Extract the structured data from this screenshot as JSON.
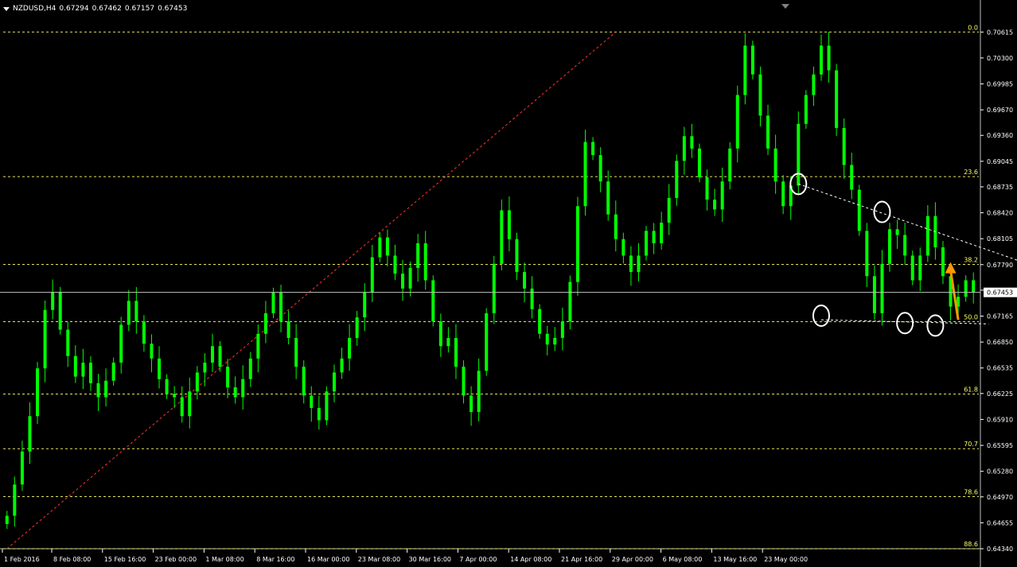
{
  "header": {
    "symbol": "NZDUSD,H4",
    "open": "0.67294",
    "high": "0.67462",
    "low": "0.67157",
    "close": "0.67453"
  },
  "colors": {
    "background": "#000000",
    "candles": "#00ff00",
    "fib_levels": "#ffff66",
    "fib_trend_line": "#ff3333",
    "pattern_markup": "#ffffff",
    "arrow": "#ff9900",
    "axis_text": "#ffffff",
    "price_line": "#c0c0c0"
  },
  "chart_data": {
    "type": "candlestick",
    "title": "NZDUSD,H4",
    "ylim": [
      0.6434,
      0.70695
    ],
    "price_axis": {
      "ticks": [
        "0.70615",
        "0.70300",
        "0.69985",
        "0.69670",
        "0.69360",
        "0.69045",
        "0.68735",
        "0.68420",
        "0.68105",
        "0.67790",
        "0.67480",
        "0.67165",
        "0.66850",
        "0.66535",
        "0.66225",
        "0.65910",
        "0.65595",
        "0.65280",
        "0.64970",
        "0.64655",
        "0.64340"
      ],
      "current_price": "0.67453"
    },
    "time_axis": {
      "labels": [
        "1 Feb 2016",
        "8 Feb 08:00",
        "15 Feb 16:00",
        "23 Feb 00:00",
        "1 Mar 08:00",
        "8 Mar 16:00",
        "16 Mar 00:00",
        "23 Mar 08:00",
        "30 Mar 16:00",
        "7 Apr 00:00",
        "14 Apr 08:00",
        "21 Apr 16:00",
        "29 Apr 00:00",
        "6 May 08:00",
        "13 May 16:00",
        "23 May 00:00"
      ]
    },
    "fibonacci": [
      {
        "label": "0.0",
        "price": 0.70615
      },
      {
        "label": "23.6",
        "price": 0.68859
      },
      {
        "label": "38.2",
        "price": 0.67793
      },
      {
        "label": "50.0",
        "price": 0.67097
      },
      {
        "label": "61.8",
        "price": 0.66218
      },
      {
        "label": "70.7",
        "price": 0.65555
      },
      {
        "label": "78.6",
        "price": 0.64972
      },
      {
        "label": "88.6",
        "price": 0.6434
      }
    ],
    "fib_trend": {
      "from": {
        "bar": 0,
        "price": 0.6434
      },
      "to": {
        "bar": 80,
        "price": 0.70615
      }
    },
    "pattern": {
      "upper_trendline": {
        "from": {
          "bar": 104,
          "price": 0.6877
        },
        "to": {
          "bar": 136,
          "price": 0.6774
        }
      },
      "lower_trendline": {
        "from": {
          "bar": 107,
          "price": 0.6712
        },
        "to": {
          "bar": 129,
          "price": 0.6707
        }
      },
      "circled_points": [
        {
          "bar": 104,
          "price": 0.6877
        },
        {
          "bar": 115,
          "price": 0.6843
        },
        {
          "bar": 107,
          "price": 0.6717
        },
        {
          "bar": 118,
          "price": 0.6708
        },
        {
          "bar": 122,
          "price": 0.6705
        }
      ],
      "arrow": {
        "from": {
          "bar": 125,
          "price": 0.6712
        },
        "to": {
          "bar": 124,
          "price": 0.6782
        }
      }
    },
    "bar_count": 128,
    "closes": [
      0.6474,
      0.6512,
      0.6552,
      0.6595,
      0.6653,
      0.6724,
      0.6746,
      0.67,
      0.6668,
      0.6643,
      0.666,
      0.6635,
      0.6618,
      0.6638,
      0.666,
      0.6706,
      0.6735,
      0.671,
      0.6683,
      0.6665,
      0.664,
      0.6622,
      0.6618,
      0.6595,
      0.6625,
      0.6648,
      0.666,
      0.668,
      0.6655,
      0.663,
      0.6618,
      0.664,
      0.6665,
      0.6695,
      0.672,
      0.6745,
      0.671,
      0.669,
      0.6655,
      0.662,
      0.6605,
      0.659,
      0.6625,
      0.6648,
      0.6665,
      0.669,
      0.6715,
      0.6745,
      0.6788,
      0.6812,
      0.679,
      0.6768,
      0.675,
      0.6775,
      0.6805,
      0.676,
      0.671,
      0.668,
      0.669,
      0.6655,
      0.662,
      0.66,
      0.665,
      0.672,
      0.678,
      0.6845,
      0.681,
      0.677,
      0.675,
      0.6725,
      0.6695,
      0.6682,
      0.669,
      0.671,
      0.6758,
      0.685,
      0.6928,
      0.6912,
      0.688,
      0.684,
      0.681,
      0.679,
      0.677,
      0.679,
      0.682,
      0.6805,
      0.683,
      0.686,
      0.6905,
      0.6935,
      0.692,
      0.6885,
      0.6858,
      0.6846,
      0.688,
      0.692,
      0.6985,
      0.7045,
      0.701,
      0.696,
      0.692,
      0.688,
      0.685,
      0.6875,
      0.695,
      0.6985,
      0.701,
      0.7045,
      0.7015,
      0.6945,
      0.69,
      0.687,
      0.682,
      0.6765,
      0.672,
      0.678,
      0.6822,
      0.6815,
      0.679,
      0.676,
      0.679,
      0.6838,
      0.68,
      0.6765,
      0.6728,
      0.674,
      0.676,
      0.6745
    ]
  }
}
